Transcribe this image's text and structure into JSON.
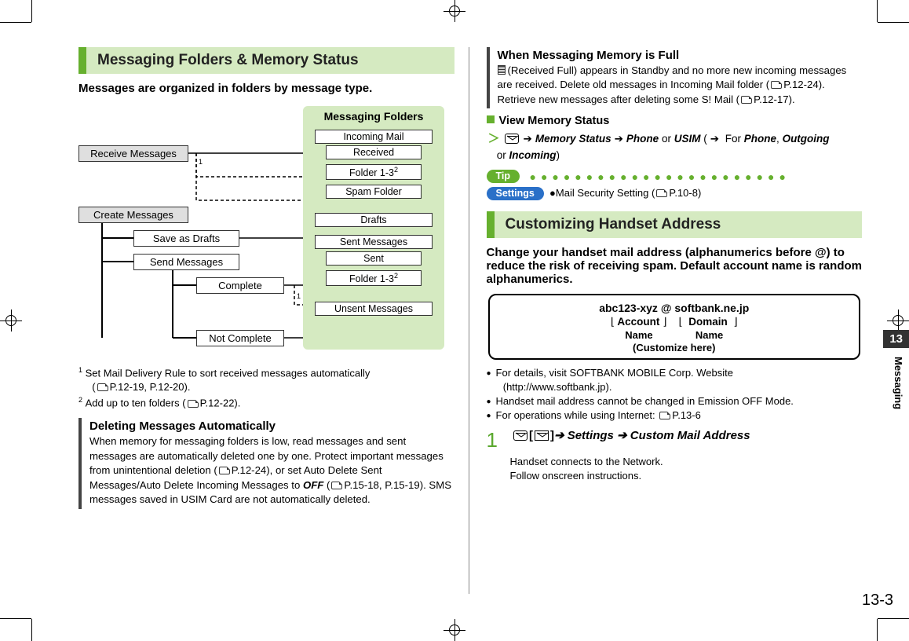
{
  "left": {
    "section_title": "Messaging Folders & Memory Status",
    "lead": "Messages are organized in folders by message type.",
    "folders_title": "Messaging Folders",
    "receive": "Receive Messages",
    "create": "Create Messages",
    "save_drafts": "Save as Drafts",
    "send_msgs": "Send Messages",
    "complete": "Complete",
    "not_complete": "Not Complete",
    "incoming_mail": "Incoming Mail",
    "received": "Received",
    "folder13a": "Folder 1-3",
    "spam": "Spam Folder",
    "drafts": "Drafts",
    "sent_messages": "Sent Messages",
    "sent": "Sent",
    "folder13b": "Folder 1-3",
    "unsent": "Unsent Messages",
    "sup2": "2",
    "note1_sup": "1",
    "note1a": "Set Mail Delivery Rule to sort received messages automatically",
    "note1b": "P.12-19, P.12-20).",
    "note2_sup": "2",
    "note2": "Add up to ten folders (",
    "note2b": "P.12-22).",
    "del_title": "Deleting Messages Automatically",
    "del_body_a": "When memory for messaging folders is low, read messages and sent messages are automatically deleted one by one. Protect important messages from unintentional deletion (",
    "del_body_b": "P.12-24), or set Auto Delete Sent Messages/Auto Delete Incoming Messages to ",
    "del_off": "OFF",
    "del_body_c": " (",
    "del_body_d": "P.15-18, P.15-19). SMS messages saved in USIM Card are not automatically deleted."
  },
  "right": {
    "full_title": "When Messaging Memory is Full",
    "full_body_a": "(Received Full) appears in Standby and no more new incoming messages are received. Delete old messages in Incoming Mail folder (",
    "full_body_b": "P.12-24). Retrieve new messages after deleting some S! Mail (",
    "full_body_c": "P.12-17).",
    "view_mem": "View Memory Status",
    "nav_mem": "Memory Status",
    "nav_phone": "Phone",
    "nav_or": " or ",
    "nav_usim": "USIM",
    "nav_for": " For ",
    "nav_phone2": "Phone",
    "nav_out": "Outgoing",
    "nav_or2": " or ",
    "nav_in": "Incoming",
    "tip": "Tip",
    "settings": "Settings",
    "setline": "Mail Security Setting (",
    "setline_b": "P.10-8)",
    "cust_title": "Customizing Handset Address",
    "cust_lead": "Change your handset mail address (alphanumerics before @) to reduce the risk of receiving spam. Default account name is random alphanumerics.",
    "addr_email": "abc123-xyz @ softbank.ne.jp",
    "addr_account": "Account",
    "addr_domain": "Domain",
    "addr_name": "Name",
    "addr_cust": "(Customize here)",
    "b1a": "For details, visit SOFTBANK MOBILE Corp. Website",
    "b1b": "(http://www.softbank.jp).",
    "b2": "Handset mail address cannot be changed in Emission OFF Mode.",
    "b3a": "For operations while using Internet: ",
    "b3b": "P.13-6",
    "step_num": "1",
    "step_settings": " Settings ",
    "step_cma": " Custom Mail Address",
    "step_sub1": "Handset connects to the Network.",
    "step_sub2": "Follow onscreen instructions.",
    "tab_num": "13",
    "tab_label": "Messaging",
    "page_num": "13-3"
  }
}
